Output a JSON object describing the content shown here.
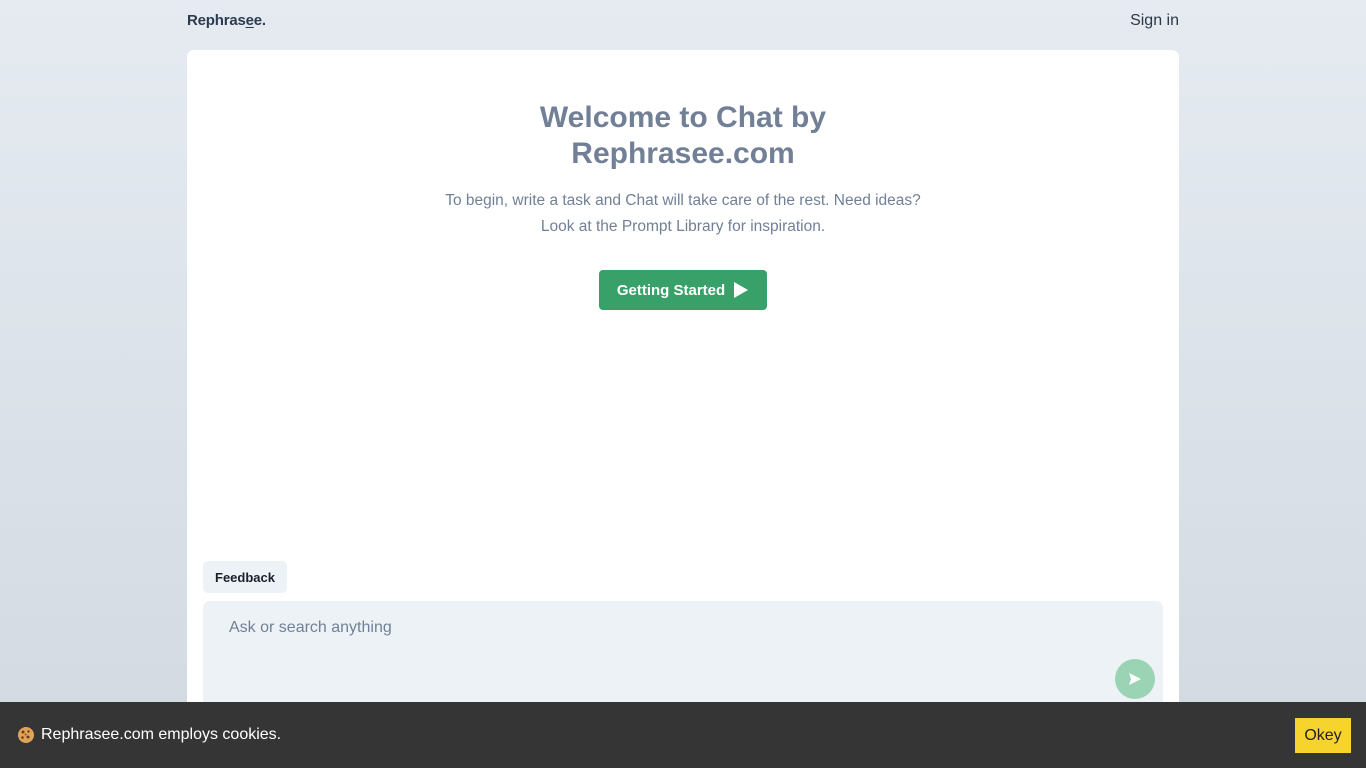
{
  "header": {
    "logo_main": "Rephras",
    "logo_underlined": "e",
    "logo_end": "e.",
    "signin_label": "Sign in"
  },
  "welcome": {
    "title_line1": "Welcome to Chat by",
    "title_line2": "Rephrasee.com",
    "subtitle_line1": "To begin, write a task and Chat will take care of the rest. Need ideas?",
    "subtitle_line2": "Look at the Prompt Library for inspiration.",
    "start_button_label": "Getting Started"
  },
  "feedback": {
    "label": "Feedback"
  },
  "chat_input": {
    "placeholder": "Ask or search anything",
    "value": ""
  },
  "cookie_banner": {
    "text": "Rephrasee.com employs cookies.",
    "accept_label": "Okey"
  },
  "colors": {
    "accent_green": "#38a169",
    "send_button": "#9ad4b4",
    "text_muted": "#718096",
    "cookie_bar": "#353535",
    "cookie_button": "#f6d32d"
  },
  "icons": {
    "start_button_icon": "play-icon",
    "send_button_icon": "send-icon",
    "cookie_icon": "cookie-icon"
  }
}
